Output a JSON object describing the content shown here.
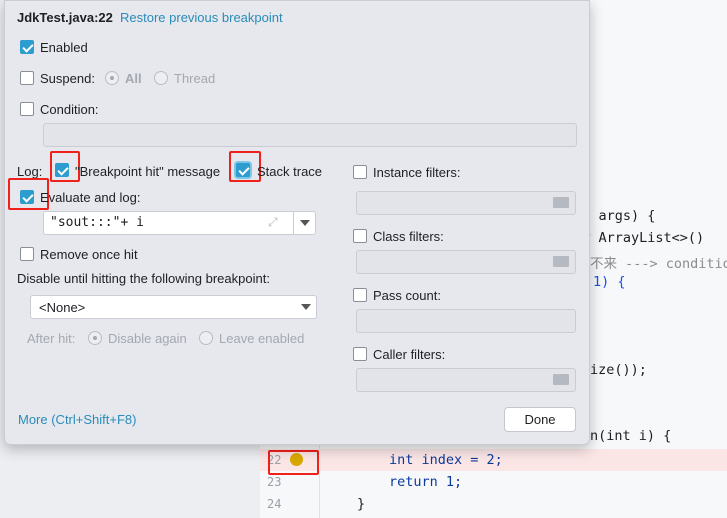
{
  "popup": {
    "title": "JdkTest.java:22",
    "restore_link": "Restore previous breakpoint",
    "enabled": "Enabled",
    "suspend": "Suspend:",
    "all": "All",
    "thread": "Thread",
    "condition": "Condition:",
    "log": "Log:",
    "breakpoint_hit": "\"Breakpoint hit\" message",
    "stack_trace": "Stack trace",
    "evaluate_and_log": "Evaluate and log:",
    "evaluate_value": "\"sout:::\"+ i",
    "remove_once_hit": "Remove once hit",
    "disable_until": "Disable until hitting the following breakpoint:",
    "none_option": "<None>",
    "after_hit": "After hit:",
    "disable_again": "Disable again",
    "leave_enabled": "Leave enabled",
    "instance_filters": "Instance filters:",
    "class_filters": "Class filters:",
    "pass_count": "Pass count:",
    "caller_filters": "Caller filters:",
    "more": "More (Ctrl+Shift+F8)",
    "done": "Done"
  },
  "editor": {
    "lines": [
      "g[] args) {",
      "new ArrayList<>()",
      "不来 ---> condition",
      "1) {",
      "ize());",
      "n(int i) {"
    ],
    "line_numbers": [
      "22",
      "23",
      "24"
    ],
    "code22": "int index = 2;",
    "code23": "return 1;",
    "code24": "}"
  }
}
